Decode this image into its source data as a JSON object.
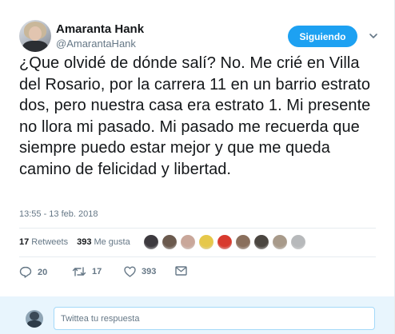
{
  "author": {
    "name": "Amaranta Hank",
    "handle": "@AmarantaHank"
  },
  "follow_button": {
    "label": "Siguiendo",
    "color": "#1da1f2"
  },
  "tweet": {
    "text": "¿Que olvidé de dónde salí? No. Me crié en Villa del Rosario, por la carrera 11 en un barrio estrato dos, pero nuestra casa era estrato 1. Mi presente no llora mi pasado. Mi pasado me recuerda que siempre puedo estar mejor y que me queda camino de felicidad y libertad.",
    "timestamp": "13:55 - 13 feb. 2018"
  },
  "stats": {
    "retweets_count": "17",
    "retweets_label": "Retweets",
    "likes_count": "393",
    "likes_label": "Me gusta"
  },
  "likers": [
    {
      "name": "liker-avatar-1",
      "color": "#3d3a3f"
    },
    {
      "name": "liker-avatar-2",
      "color": "#6b5a4e"
    },
    {
      "name": "liker-avatar-3",
      "color": "#c9a79a"
    },
    {
      "name": "liker-avatar-4",
      "color": "#e6c84a"
    },
    {
      "name": "liker-avatar-5",
      "color": "#d83a2e"
    },
    {
      "name": "liker-avatar-6",
      "color": "#8a6f5c"
    },
    {
      "name": "liker-avatar-7",
      "color": "#4b4640"
    },
    {
      "name": "liker-avatar-8",
      "color": "#a89a8a"
    },
    {
      "name": "liker-avatar-9",
      "color": "#b7b9bb"
    }
  ],
  "actions": {
    "reply_count": "20",
    "retweet_count": "17",
    "like_count": "393"
  },
  "reply_box": {
    "placeholder": "Twittea tu respuesta"
  },
  "icons": [
    "caret-down-icon",
    "reply-icon",
    "retweet-icon",
    "like-icon",
    "message-icon"
  ],
  "colors": {
    "accent": "#1da1f2",
    "muted_text": "#657786",
    "reply_bar_bg": "#e8f5fd"
  }
}
